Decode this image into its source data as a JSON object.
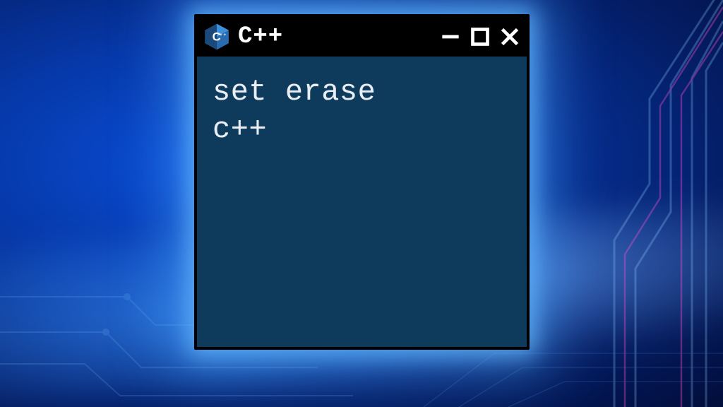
{
  "window": {
    "title": "C++",
    "icon": "cpp-logo-icon"
  },
  "content": {
    "line1": "set erase",
    "line2": "c++"
  }
}
